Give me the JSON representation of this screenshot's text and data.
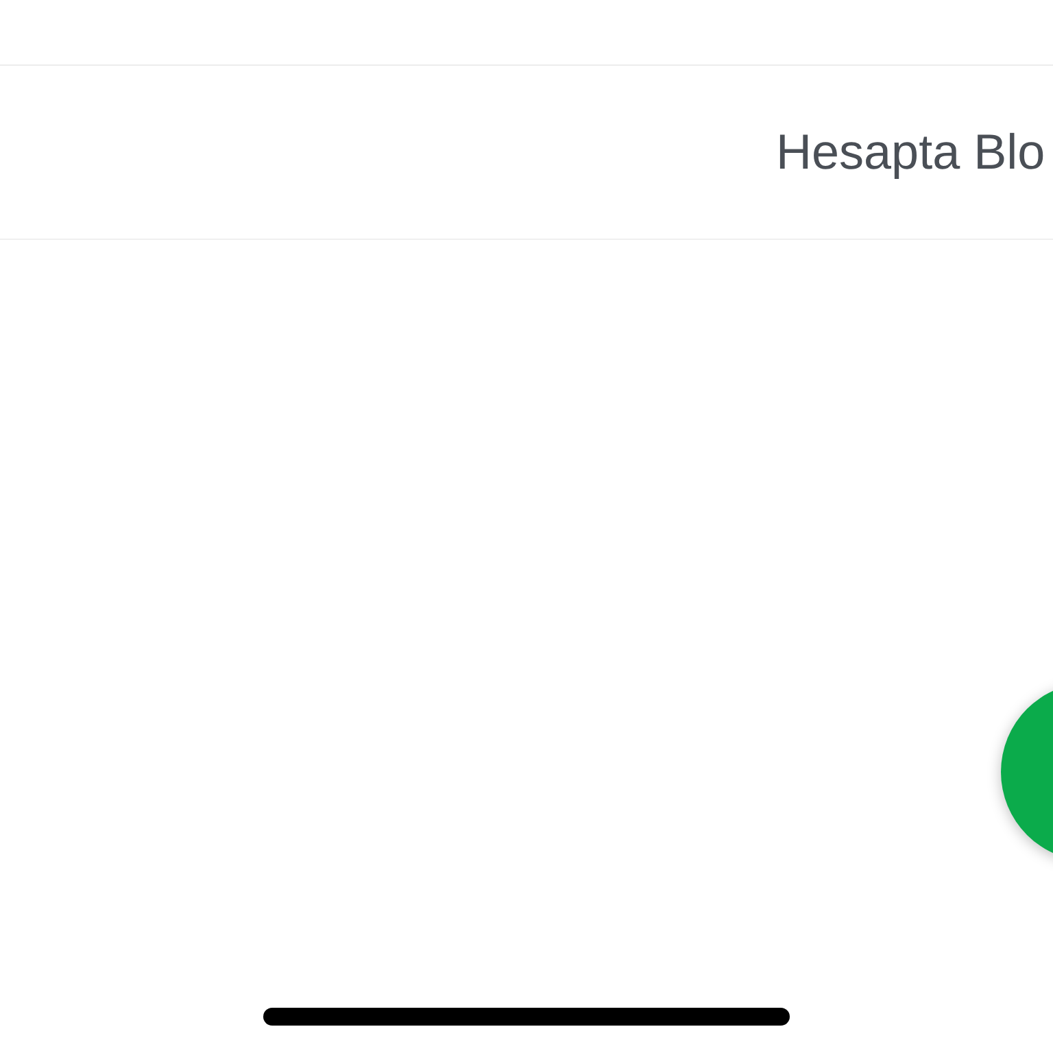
{
  "header": {
    "title": "Hesapta Blo"
  }
}
